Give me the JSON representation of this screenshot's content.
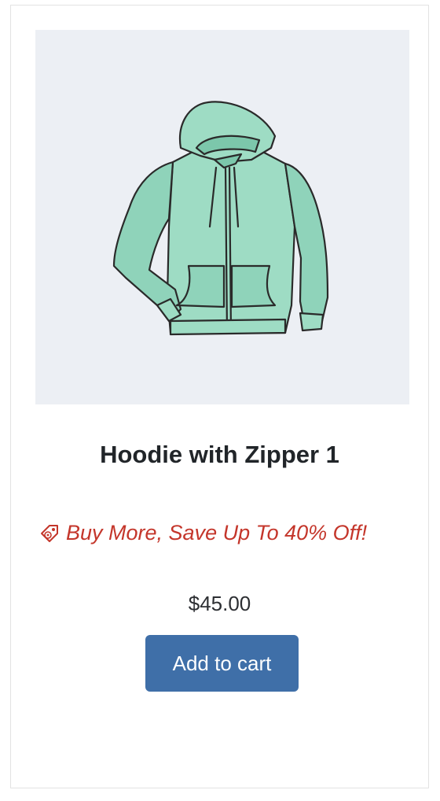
{
  "product": {
    "image_alt": "hoodie illustration",
    "title": "Hoodie with Zipper 1",
    "promo_text": "Buy More, Save Up To 40% Off!",
    "promo_icon": "price-tag-icon",
    "price": "$45.00",
    "add_to_cart_label": "Add to cart"
  },
  "colors": {
    "image_background": "#eceff4",
    "hoodie_fill": "#9edcc4",
    "promo_red": "#c4362b",
    "button_blue": "#3f6fa8"
  }
}
